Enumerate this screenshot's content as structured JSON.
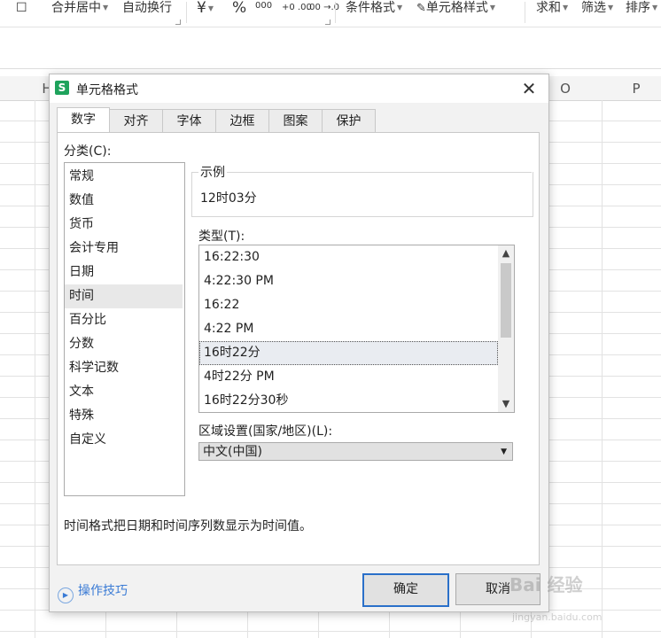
{
  "toolbar": {
    "merge_center": "合并居中",
    "auto_wrap": "自动换行",
    "currency_symbol": "¥",
    "percent_symbol": "%",
    "thousands_symbol": "000",
    "inc_decimal": "+0 .00",
    "dec_decimal": ".00 →.0",
    "cond_format": "条件格式",
    "cell_style": "单元格样式",
    "sum": "求和",
    "filter": "筛选",
    "sort": "排序"
  },
  "columns": {
    "h": "H",
    "o": "O",
    "p": "P"
  },
  "dialog": {
    "title": "单元格格式",
    "tabs": [
      "数字",
      "对齐",
      "字体",
      "边框",
      "图案",
      "保护"
    ],
    "active_tab": "数字",
    "category_label": "分类(C):",
    "categories": [
      "常规",
      "数值",
      "货币",
      "会计专用",
      "日期",
      "时间",
      "百分比",
      "分数",
      "科学记数",
      "文本",
      "特殊",
      "自定义"
    ],
    "selected_category": "时间",
    "sample_label": "示例",
    "sample_value": "12时03分",
    "type_label": "类型(T):",
    "types": [
      "16:22:30",
      "4:22:30 PM",
      "16:22",
      "4:22 PM",
      "16时22分",
      "4时22分 PM",
      "16时22分30秒"
    ],
    "selected_type": "16时22分",
    "locale_label": "区域设置(国家/地区)(L):",
    "locale_value": "中文(中国)",
    "description": "时间格式把日期和时间序列数显示为时间值。",
    "tips_link": "操作技巧",
    "ok_label": "确定",
    "cancel_label": "取消"
  },
  "watermark": {
    "text": "Bai 经验",
    "url": "jingyan.baidu.com"
  }
}
